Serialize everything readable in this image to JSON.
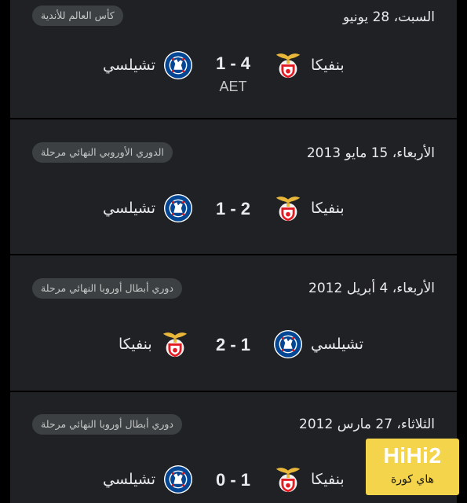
{
  "matches": [
    {
      "date": "السبت، 28 يونيو",
      "competition": "كأس العالم للأندية",
      "home": {
        "name": "بنفيكا",
        "crest": "benfica-crest-icon"
      },
      "away": {
        "name": "تشيلسي",
        "crest": "chelsea-crest-icon"
      },
      "score": "1 - 4",
      "note": "AET"
    },
    {
      "date": "الأربعاء، 15 مايو 2013",
      "competition": "الدوري الأوروبي النهائي  مرحلة",
      "home": {
        "name": "بنفيكا",
        "crest": "benfica-crest-icon"
      },
      "away": {
        "name": "تشيلسي",
        "crest": "chelsea-crest-icon"
      },
      "score": "1 - 2"
    },
    {
      "date": "الأربعاء، 4 أبريل 2012",
      "competition": "دوري أبطال أوروبا النهائي  مرحلة",
      "home": {
        "name": "تشيلسي",
        "crest": "chelsea-crest-icon"
      },
      "away": {
        "name": "بنفيكا",
        "crest": "benfica-crest-icon"
      },
      "score": "2 - 1"
    },
    {
      "date": "الثلاثاء، 27 مارس 2012",
      "competition": "دوري أبطال أوروبا النهائي  مرحلة",
      "home": {
        "name": "بنفيكا",
        "crest": "benfica-crest-icon"
      },
      "away": {
        "name": "تشيلسي",
        "crest": "chelsea-crest-icon"
      },
      "score": "0 - 1"
    }
  ],
  "watermark": {
    "main": "HiHi2",
    "sub": "هاي كورة",
    "color": "#f3d44a"
  },
  "colors": {
    "background": "#202124",
    "divider": "#000000",
    "badge": "#3c4043",
    "text": "#e8eaed"
  }
}
